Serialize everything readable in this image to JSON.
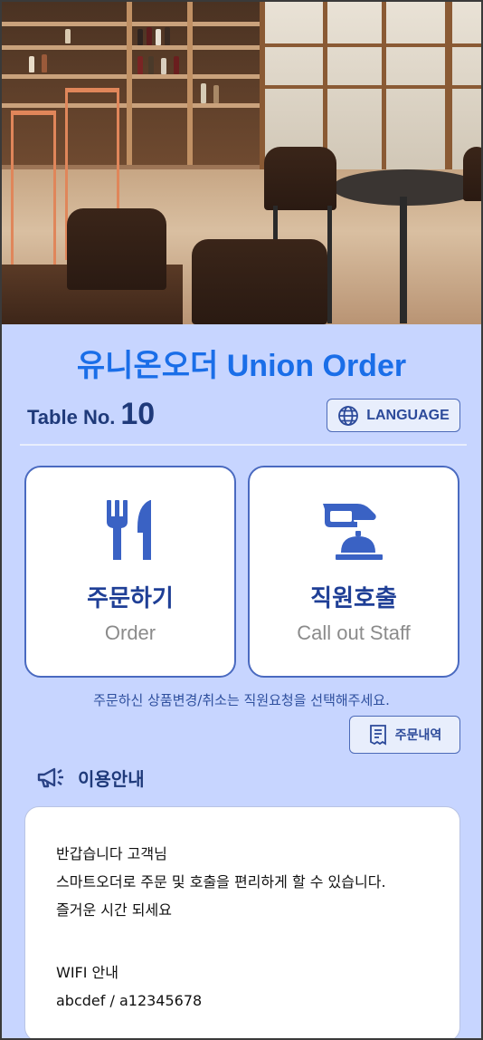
{
  "header": {
    "title": "유니온오더 Union Order",
    "table_label": "Table No.",
    "table_number": "10",
    "language_button": "LANGUAGE"
  },
  "cards": {
    "order": {
      "label_ko": "주문하기",
      "label_en": "Order",
      "icon": "fork-knife-icon"
    },
    "staff": {
      "label_ko": "직원호출",
      "label_en": "Call out Staff",
      "icon": "service-bell-hand-icon"
    }
  },
  "notice": "주문하신 상품변경/취소는 직원요청을 선택해주세요.",
  "order_history_button": "주문내역",
  "guide": {
    "heading": "이용안내",
    "lines": [
      "반갑습니다 고객님",
      "스마트오더로 주문 및 호출을 편리하게 할 수 있습니다.",
      "즐거운 시간 되세요",
      "WIFI 안내",
      "abcdef / a12345678"
    ]
  },
  "colors": {
    "background": "#c7d5ff",
    "title": "#1a6ee8",
    "accent": "#2c4a9a",
    "card_border": "#4a6ac0"
  }
}
